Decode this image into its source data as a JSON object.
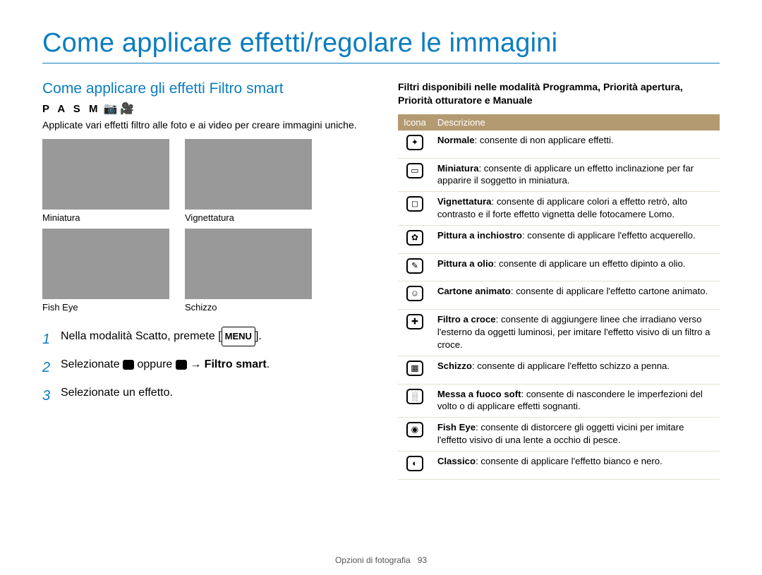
{
  "title": "Come applicare effetti/regolare le immagini",
  "left": {
    "section_title": "Come applicare gli effetti Filtro smart",
    "modes": "P A S M",
    "modes_glyphs": "📷 🎥",
    "intro": "Applicate vari effetti filtro alle foto e ai video per creare immagini uniche.",
    "examples": [
      {
        "caption": "Miniatura"
      },
      {
        "caption": "Vignettatura"
      },
      {
        "caption": "Fish Eye"
      },
      {
        "caption": "Schizzo"
      }
    ],
    "steps": {
      "s1_pre": "Nella modalità Scatto, premete [",
      "s1_menu": "MENU",
      "s1_post": "].",
      "s2_pre": "Selezionate ",
      "s2_mid": " oppure ",
      "s2_arrow": " → ",
      "s2_bold": "Filtro smart",
      "s2_post": ".",
      "s3": "Selezionate un effetto."
    }
  },
  "right": {
    "intro": "Filtri disponibili nelle modalità Programma, Priorità apertura, Priorità otturatore e Manuale",
    "table_header_icon": "Icona",
    "table_header_desc": "Descrizione",
    "rows": [
      {
        "glyph": "✦",
        "bold": "Normale",
        "text": ": consente di non applicare effetti."
      },
      {
        "glyph": "▭",
        "bold": "Miniatura",
        "text": ": consente di applicare un effetto inclinazione per far apparire il soggetto in miniatura."
      },
      {
        "glyph": "◻",
        "bold": "Vignettatura",
        "text": ": consente di applicare colori a effetto retrò, alto contrasto e il forte effetto vignetta delle fotocamere Lomo."
      },
      {
        "glyph": "✿",
        "bold": "Pittura a inchiostro",
        "text": ": consente di applicare l'effetto acquerello."
      },
      {
        "glyph": "✎",
        "bold": "Pittura a olio",
        "text": ": consente di applicare un effetto dipinto a olio."
      },
      {
        "glyph": "☺",
        "bold": "Cartone animato",
        "text": ": consente di applicare l'effetto cartone animato."
      },
      {
        "glyph": "✚",
        "bold": "Filtro a croce",
        "text": ": consente di aggiungere linee che irradiano verso l'esterno da oggetti luminosi, per imitare l'effetto visivo di un filtro a croce."
      },
      {
        "glyph": "▦",
        "bold": "Schizzo",
        "text": ": consente di applicare l'effetto schizzo a penna."
      },
      {
        "glyph": "░",
        "bold": "Messa a fuoco soft",
        "text": ": consente di nascondere le imperfezioni del volto o di applicare effetti sognanti."
      },
      {
        "glyph": "◉",
        "bold": "Fish Eye",
        "text": ": consente di distorcere gli oggetti vicini per imitare l'effetto visivo di una lente a occhio di pesce."
      },
      {
        "glyph": "◐",
        "bold": "Classico",
        "text": ": consente di applicare l'effetto bianco e nero."
      }
    ]
  },
  "footer": {
    "section": "Opzioni di fotografia",
    "page": "93"
  }
}
